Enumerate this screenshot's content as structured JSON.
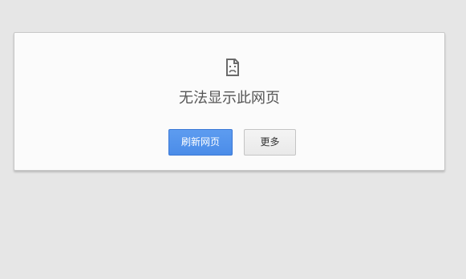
{
  "error": {
    "icon": "sad-page-icon",
    "title": "无法显示此网页"
  },
  "buttons": {
    "reload_label": "刷新网页",
    "more_label": "更多"
  },
  "colors": {
    "background": "#e6e6e6",
    "card": "#fbfbfb",
    "primary_button": "#4b8ce8",
    "secondary_button": "#ececec"
  }
}
